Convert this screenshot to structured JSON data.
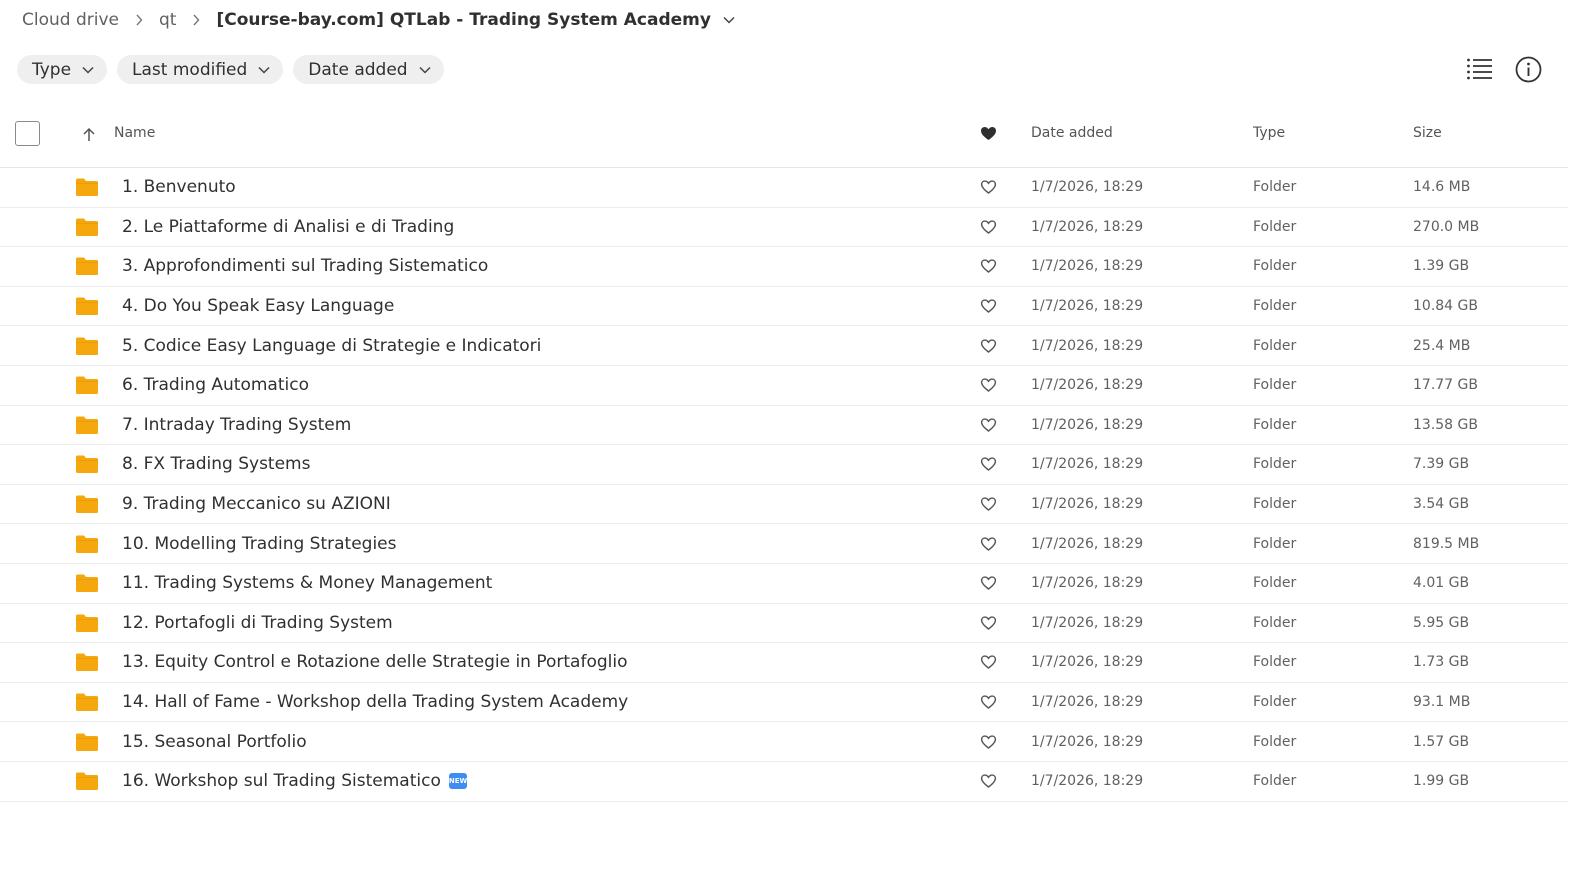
{
  "breadcrumb": {
    "root": "Cloud drive",
    "parent": "qt",
    "current": "[Course-bay.com] QTLab - Trading System Academy"
  },
  "filters": [
    {
      "label": "Type"
    },
    {
      "label": "Last modified"
    },
    {
      "label": "Date added"
    }
  ],
  "columns": {
    "name": "Name",
    "date_added": "Date added",
    "type": "Type",
    "size": "Size"
  },
  "colors": {
    "folder": "#f5a80d",
    "text": "#303030",
    "muted": "#616161"
  },
  "rows": [
    {
      "name": "1. Benvenuto",
      "date": "1/7/2026, 18:29",
      "type": "Folder",
      "size": "14.6 MB"
    },
    {
      "name": "2. Le Piattaforme di Analisi e di Trading",
      "date": "1/7/2026, 18:29",
      "type": "Folder",
      "size": "270.0 MB"
    },
    {
      "name": "3. Approfondimenti sul Trading Sistematico",
      "date": "1/7/2026, 18:29",
      "type": "Folder",
      "size": "1.39 GB"
    },
    {
      "name": "4. Do You Speak Easy Language",
      "date": "1/7/2026, 18:29",
      "type": "Folder",
      "size": "10.84 GB"
    },
    {
      "name": "5. Codice Easy Language di Strategie e Indicatori",
      "date": "1/7/2026, 18:29",
      "type": "Folder",
      "size": "25.4 MB"
    },
    {
      "name": "6. Trading Automatico",
      "date": "1/7/2026, 18:29",
      "type": "Folder",
      "size": "17.77 GB"
    },
    {
      "name": "7. Intraday Trading System",
      "date": "1/7/2026, 18:29",
      "type": "Folder",
      "size": "13.58 GB"
    },
    {
      "name": "8. FX Trading Systems",
      "date": "1/7/2026, 18:29",
      "type": "Folder",
      "size": "7.39 GB"
    },
    {
      "name": "9. Trading Meccanico su AZIONI",
      "date": "1/7/2026, 18:29",
      "type": "Folder",
      "size": "3.54 GB"
    },
    {
      "name": "10. Modelling Trading Strategies",
      "date": "1/7/2026, 18:29",
      "type": "Folder",
      "size": "819.5 MB"
    },
    {
      "name": "11. Trading Systems & Money Management",
      "date": "1/7/2026, 18:29",
      "type": "Folder",
      "size": "4.01 GB"
    },
    {
      "name": "12. Portafogli di Trading System",
      "date": "1/7/2026, 18:29",
      "type": "Folder",
      "size": "5.95 GB"
    },
    {
      "name": "13. Equity Control e Rotazione delle Strategie in Portafoglio",
      "date": "1/7/2026, 18:29",
      "type": "Folder",
      "size": "1.73 GB"
    },
    {
      "name": "14. Hall of Fame - Workshop della Trading System Academy",
      "date": "1/7/2026, 18:29",
      "type": "Folder",
      "size": "93.1 MB"
    },
    {
      "name": "15. Seasonal Portfolio",
      "date": "1/7/2026, 18:29",
      "type": "Folder",
      "size": "1.57 GB"
    },
    {
      "name": "16. Workshop sul Trading Sistematico",
      "badge": "NEW",
      "date": "1/7/2026, 18:29",
      "type": "Folder",
      "size": "1.99 GB"
    }
  ]
}
